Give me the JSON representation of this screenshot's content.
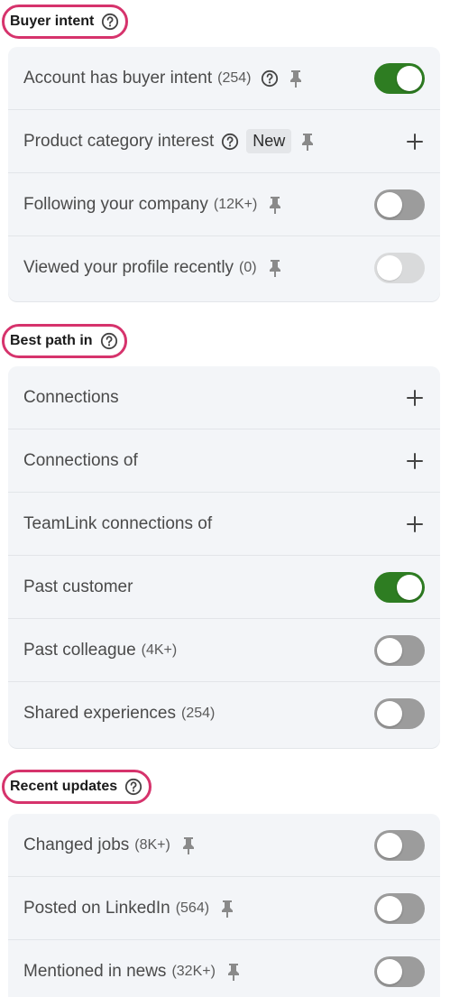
{
  "sections": [
    {
      "title": "Buyer intent",
      "rows": [
        {
          "label": "Account has buyer intent",
          "count": "(254)"
        },
        {
          "label": "Product category interest",
          "badge": "New"
        },
        {
          "label": "Following your company",
          "count": "(12K+)"
        },
        {
          "label": "Viewed your profile recently",
          "count": "(0)"
        }
      ]
    },
    {
      "title": "Best path in",
      "rows": [
        {
          "label": "Connections"
        },
        {
          "label": "Connections of"
        },
        {
          "label": "TeamLink connections of"
        },
        {
          "label": "Past customer"
        },
        {
          "label": "Past colleague",
          "count": "(4K+)"
        },
        {
          "label": "Shared experiences",
          "count": "(254)"
        }
      ]
    },
    {
      "title": "Recent updates",
      "rows": [
        {
          "label": "Changed jobs",
          "count": "(8K+)"
        },
        {
          "label": "Posted on LinkedIn",
          "count": "(564)"
        },
        {
          "label": "Mentioned in news",
          "count": "(32K+)"
        }
      ]
    }
  ],
  "toggle_states": {
    "account_buyer_intent": "on",
    "following_company": "off",
    "viewed_profile": "disabled",
    "past_customer": "on",
    "past_colleague": "off",
    "shared_experiences": "off",
    "changed_jobs": "off",
    "posted_linkedin": "off",
    "mentioned_news": "off"
  },
  "colors": {
    "highlight": "#d6336c",
    "toggle_on": "#2e7d22",
    "toggle_off": "#9c9c9c",
    "panel_bg": "#f3f5f8"
  }
}
